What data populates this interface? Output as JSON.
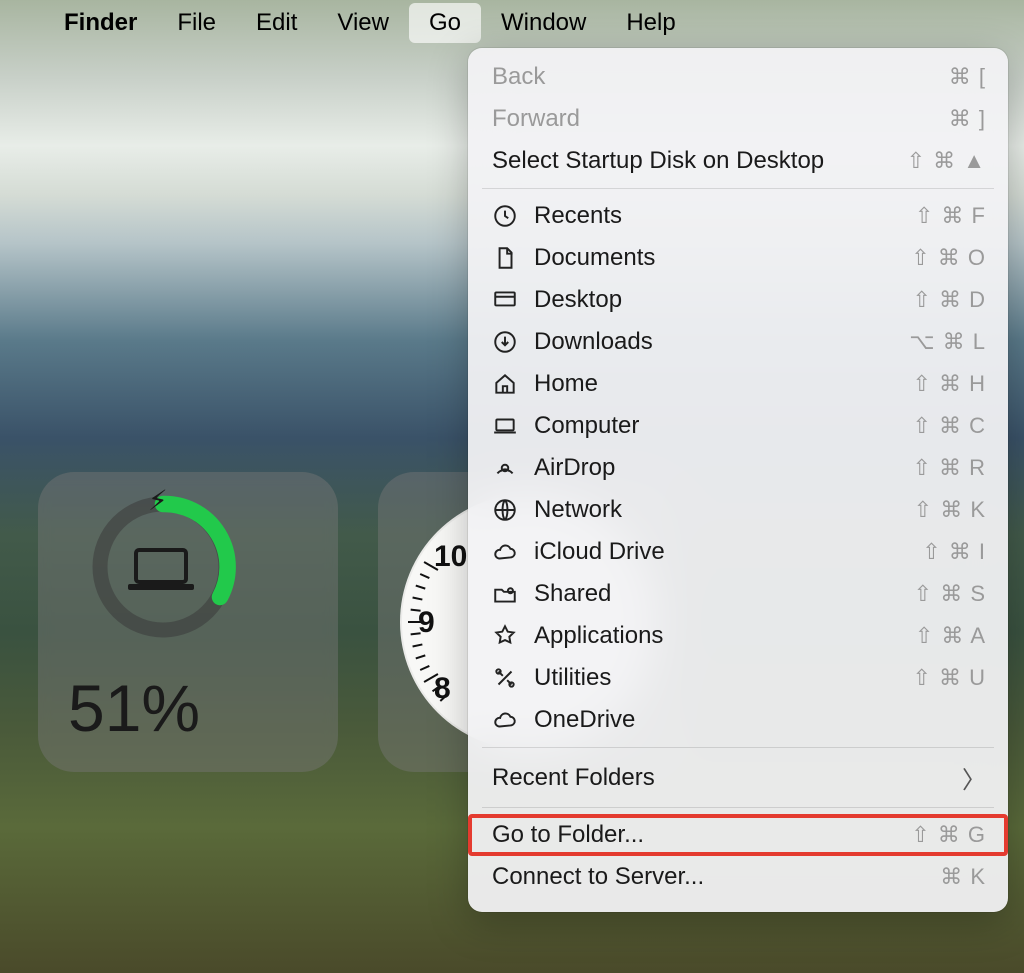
{
  "menubar": {
    "app": "Finder",
    "items": [
      "File",
      "Edit",
      "View",
      "Go",
      "Window",
      "Help"
    ],
    "active": "Go"
  },
  "dropdown": {
    "back": {
      "label": "Back",
      "shortcut": "⌘ ["
    },
    "forward": {
      "label": "Forward",
      "shortcut": "⌘ ]"
    },
    "startup": {
      "label": "Select Startup Disk on Desktop",
      "shortcut": "⇧ ⌘ ▲"
    },
    "items": [
      {
        "icon": "clock",
        "label": "Recents",
        "shortcut": "⇧ ⌘ F"
      },
      {
        "icon": "document",
        "label": "Documents",
        "shortcut": "⇧ ⌘ O"
      },
      {
        "icon": "desktop",
        "label": "Desktop",
        "shortcut": "⇧ ⌘ D"
      },
      {
        "icon": "download",
        "label": "Downloads",
        "shortcut": "⌥ ⌘ L"
      },
      {
        "icon": "home",
        "label": "Home",
        "shortcut": "⇧ ⌘ H"
      },
      {
        "icon": "computer",
        "label": "Computer",
        "shortcut": "⇧ ⌘ C"
      },
      {
        "icon": "airdrop",
        "label": "AirDrop",
        "shortcut": "⇧ ⌘ R"
      },
      {
        "icon": "network",
        "label": "Network",
        "shortcut": "⇧ ⌘ K"
      },
      {
        "icon": "cloud",
        "label": "iCloud Drive",
        "shortcut": "⇧ ⌘ I"
      },
      {
        "icon": "shared",
        "label": "Shared",
        "shortcut": "⇧ ⌘ S"
      },
      {
        "icon": "apps",
        "label": "Applications",
        "shortcut": "⇧ ⌘ A"
      },
      {
        "icon": "utilities",
        "label": "Utilities",
        "shortcut": "⇧ ⌘ U"
      },
      {
        "icon": "onedrive",
        "label": "OneDrive",
        "shortcut": ""
      }
    ],
    "recent_folders": {
      "label": "Recent Folders"
    },
    "goto": {
      "label": "Go to Folder...",
      "shortcut": "⇧ ⌘ G"
    },
    "connect": {
      "label": "Connect to Server...",
      "shortcut": "⌘ K"
    }
  },
  "battery_widget": {
    "percent": "51%"
  },
  "clock_widget": {
    "visible_numerals": [
      "10",
      "9",
      "8"
    ]
  }
}
